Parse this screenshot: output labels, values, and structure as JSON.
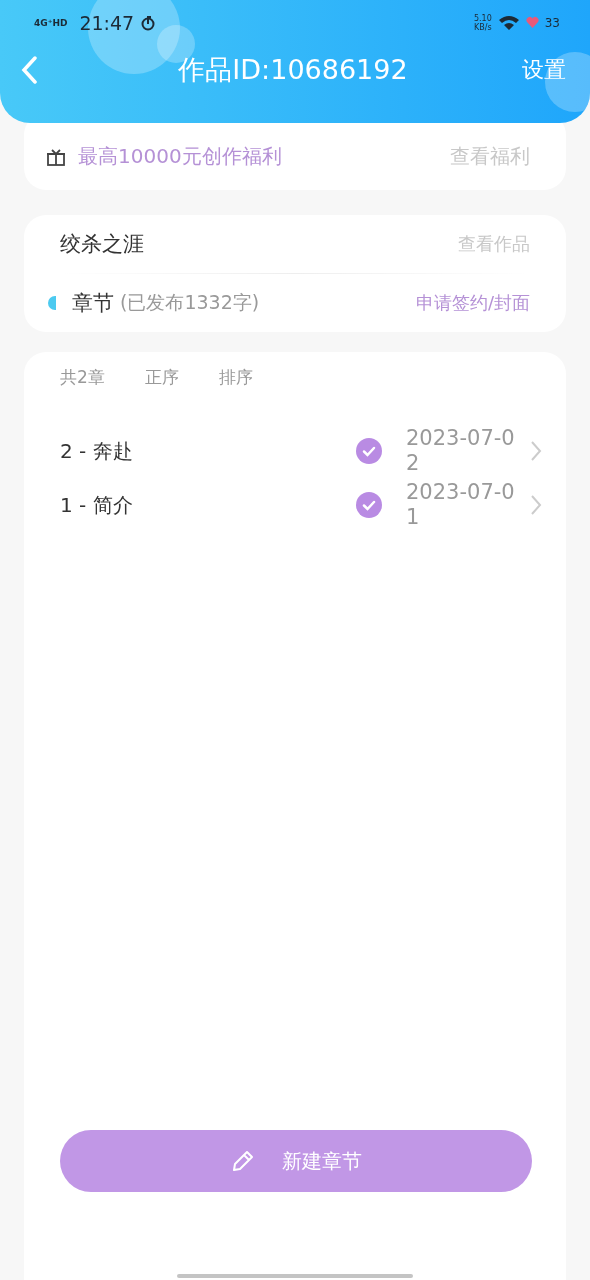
{
  "status_bar": {
    "network": "4G⁺HD",
    "time": "21:47",
    "speed": "5.10",
    "speed_unit": "KB/s",
    "battery": "33"
  },
  "nav": {
    "title": "作品ID:10686192",
    "action": "设置"
  },
  "benefit": {
    "text": "最高10000元创作福利",
    "link": "查看福利"
  },
  "work": {
    "title": "绞杀之涯",
    "link": "查看作品",
    "section": "章节",
    "section_note": "(已发布1332字)",
    "section_link": "申请签约/封面"
  },
  "chapters_header": {
    "count": "共2章",
    "order": "正序",
    "sort": "排序"
  },
  "chapters": [
    {
      "title": "2 - 奔赴",
      "published": true,
      "date": "2023-07-02"
    },
    {
      "title": "1 - 简介",
      "published": true,
      "date": "2023-07-01"
    }
  ],
  "new_button": "新建章节"
}
